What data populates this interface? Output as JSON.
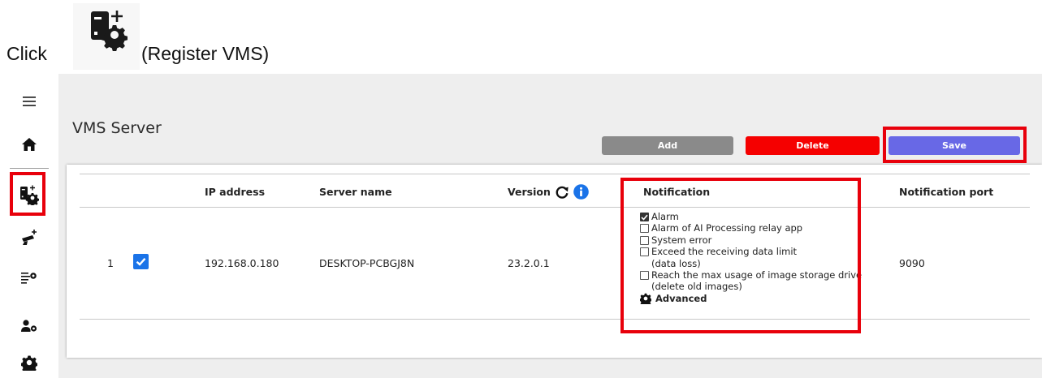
{
  "caption": {
    "prefix": "Click",
    "suffix": "(Register VMS)",
    "icon": "register-vms-icon"
  },
  "sidebar": {
    "items": [
      {
        "name": "menu",
        "icon": "hamburger-icon"
      },
      {
        "name": "home",
        "icon": "home-icon"
      },
      {
        "name": "register-vms",
        "icon": "register-vms-icon",
        "selected": true
      },
      {
        "name": "cameras",
        "icon": "camera-add-icon"
      },
      {
        "name": "list-settings",
        "icon": "list-settings-icon"
      },
      {
        "name": "user-settings",
        "icon": "user-settings-icon"
      },
      {
        "name": "settings",
        "icon": "gear-icon"
      }
    ]
  },
  "page": {
    "title": "VMS Server"
  },
  "toolbar": {
    "add_label": "Add",
    "delete_label": "Delete",
    "save_label": "Save"
  },
  "table": {
    "columns": {
      "ip": "IP address",
      "server": "Server name",
      "version": "Version",
      "notification": "Notification",
      "port": "Notification port"
    },
    "rows": [
      {
        "index": "1",
        "selected": true,
        "ip": "192.168.0.180",
        "server": "DESKTOP-PCBGJ8N",
        "version": "23.2.0.1",
        "port": "9090",
        "notifications": [
          {
            "lines": [
              "Alarm"
            ],
            "checked": true
          },
          {
            "lines": [
              "Alarm of AI Processing relay app"
            ],
            "checked": false
          },
          {
            "lines": [
              "System error"
            ],
            "checked": false
          },
          {
            "lines": [
              "Exceed the receiving data limit",
              "(data loss)"
            ],
            "checked": false
          },
          {
            "lines": [
              "Reach the max usage of image storage drive",
              "(delete old images)"
            ],
            "checked": false
          }
        ],
        "advanced_label": "Advanced"
      }
    ]
  },
  "colors": {
    "highlight": "#e8000b",
    "add": "#8a8a8a",
    "delete": "#f50000",
    "save": "#6868e6",
    "checkbox": "#1a73e8",
    "info": "#1a73e8"
  }
}
